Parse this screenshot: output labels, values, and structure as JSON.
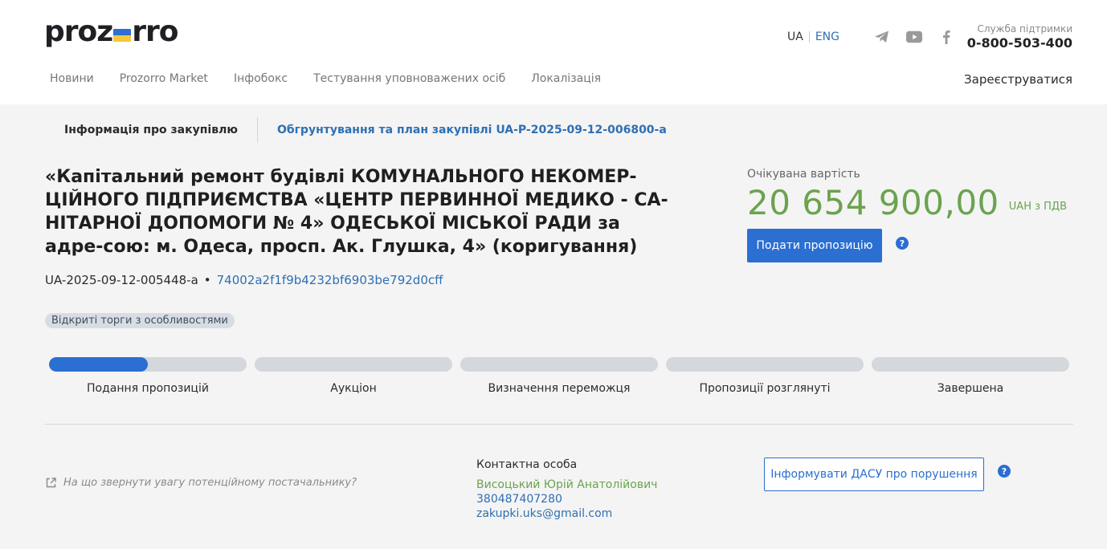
{
  "header": {
    "logo_left": "proz",
    "logo_right": "rro",
    "lang_ua": "UA",
    "lang_en": "ENG",
    "support_label": "Служба підтримки",
    "support_phone": "0-800-503-400",
    "register": "Зареєструватися",
    "nav": [
      "Новини",
      "Prozorro Market",
      "Інфобокс",
      "Тестування уповноважених осіб",
      "Локалізація"
    ],
    "social_icons": [
      "telegram-icon",
      "youtube-icon",
      "facebook-icon"
    ]
  },
  "tabs": {
    "info": "Інформація про закупівлю",
    "plan": "Обгрунтування та план закупівлі UA-P-2025-09-12-006800-a"
  },
  "tender": {
    "title": "«Капітальний ремонт будівлі КОМУНАЛЬНОГО НЕКОМЕР-ЦІЙНОГО ПІДПРИЄМСТВА «ЦЕНТР ПЕРВИННОЇ МЕДИКО - СА-НІТАРНОЇ ДОПОМОГИ № 4» ОДЕСЬКОЇ МІСЬКОЇ РАДИ за адре-сою: м. Одеса, просп. Ак. Глушка, 4» (коригування)",
    "id": "UA-2025-09-12-005448-a",
    "separator": "•",
    "hash": "74002a2f1f9b4232bf6903be792d0cff",
    "procedure": "Відкриті торги з особливостями"
  },
  "value": {
    "label": "Очікувана вартість",
    "amount": "20 654 900,00",
    "currency": "UAH з ПДВ",
    "submit_button": "Подати пропозицію",
    "help": "?"
  },
  "stages": {
    "items": [
      "Подання пропозицій",
      "Аукціон",
      "Визначення переможця",
      "Пропозиції розглянуті",
      "Завершена"
    ],
    "active_index": 0,
    "active_progress": 0.5
  },
  "footer": {
    "hint": "На що звернути увагу потенційному постачальнику?",
    "contact_header": "Контактна особа",
    "contact_name": "Висоцький Юрій Анатолійович",
    "contact_phone": "380487407280",
    "contact_email": "zakupki.uks@gmail.com",
    "dasu_button": "Інформувати ДАСУ про порушення",
    "help": "?"
  },
  "colors": {
    "accent": "#2a6fd1",
    "link": "#2f6fb3",
    "price": "#6ba34f",
    "bar_bg": "#d4d7db"
  }
}
